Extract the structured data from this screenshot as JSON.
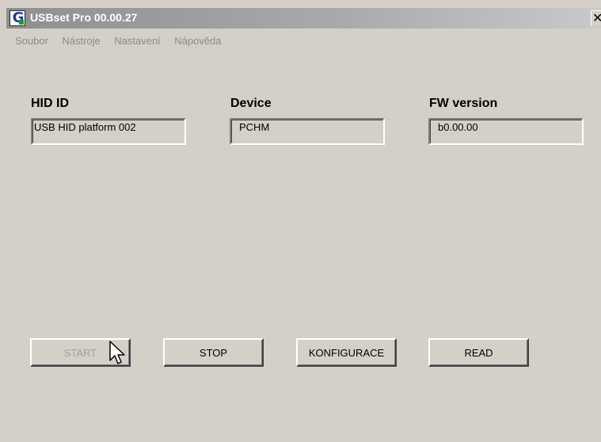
{
  "window": {
    "title": "USBset Pro 00.00.27",
    "icon": "G"
  },
  "menu": {
    "items": [
      "Soubor",
      "Nástroje",
      "Nastavení",
      "Nápověda"
    ]
  },
  "fields": {
    "hid_id": {
      "label": "HID ID",
      "value": "USB HID platform 002"
    },
    "device": {
      "label": "Device",
      "value": "PCHM"
    },
    "fw_version": {
      "label": "FW version",
      "value": "b0.00.00"
    }
  },
  "buttons": {
    "start": {
      "label": "START",
      "enabled": false
    },
    "stop": {
      "label": "STOP",
      "enabled": true
    },
    "konfigurace": {
      "label": "KONFIGURACE",
      "enabled": true
    },
    "read": {
      "label": "READ",
      "enabled": true
    }
  },
  "colors": {
    "background": "#d4d0c8",
    "menu_text": "#8a8a8a",
    "disabled_text": "#a0a0a0"
  }
}
